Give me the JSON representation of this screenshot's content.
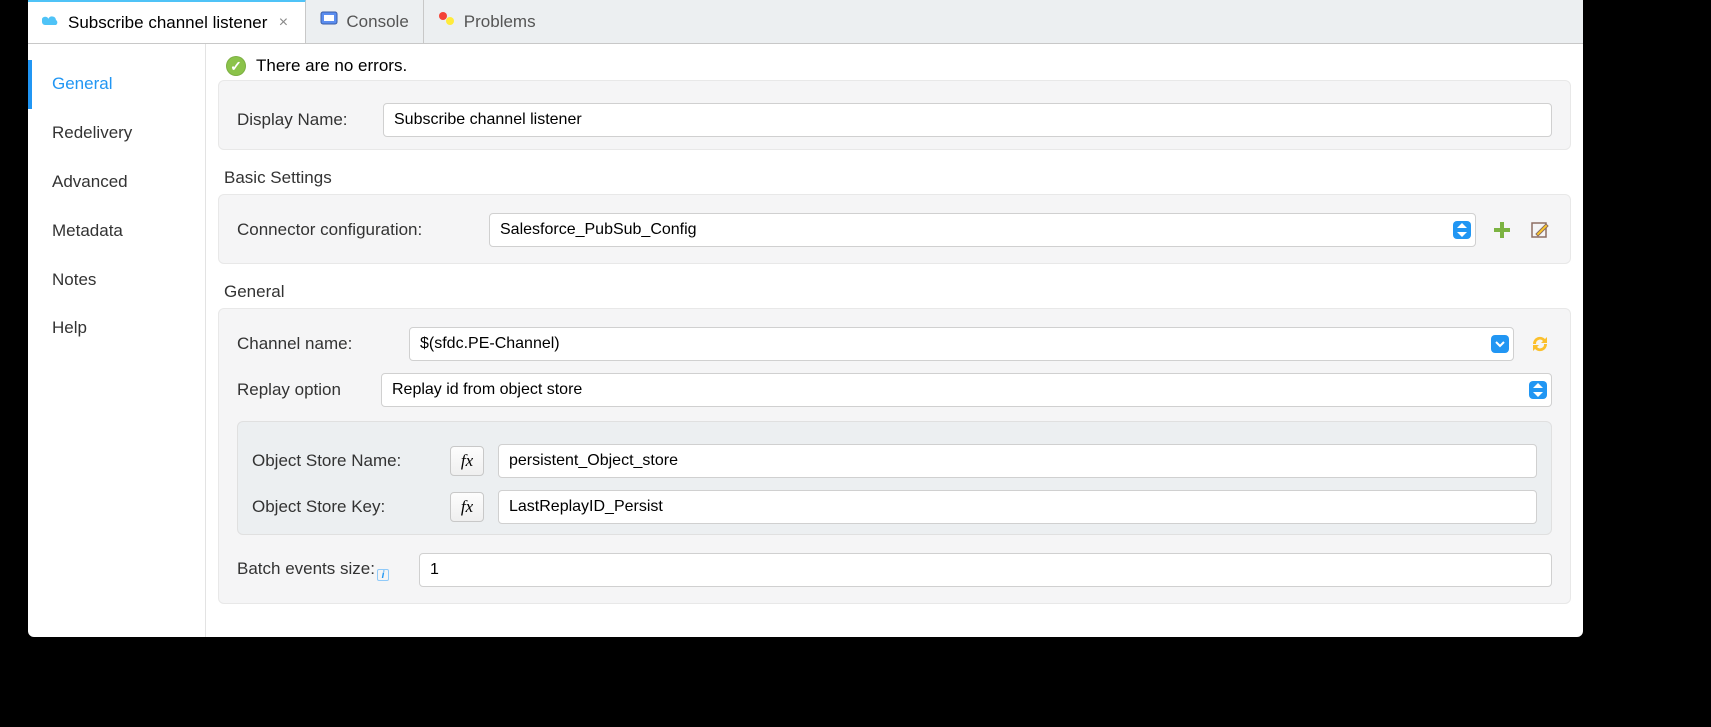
{
  "tabs": {
    "active": {
      "label": "Subscribe channel listener"
    },
    "console": {
      "label": "Console"
    },
    "problems": {
      "label": "Problems"
    }
  },
  "sidebar": {
    "items": [
      {
        "label": "General",
        "active": true
      },
      {
        "label": "Redelivery",
        "active": false
      },
      {
        "label": "Advanced",
        "active": false
      },
      {
        "label": "Metadata",
        "active": false
      },
      {
        "label": "Notes",
        "active": false
      },
      {
        "label": "Help",
        "active": false
      }
    ]
  },
  "status": {
    "text": "There are no errors."
  },
  "fields": {
    "display_name": {
      "label": "Display Name:",
      "value": "Subscribe channel listener"
    },
    "basic_heading": "Basic Settings",
    "connector": {
      "label": "Connector configuration:",
      "value": "Salesforce_PubSub_Config"
    },
    "general_heading": "General",
    "channel_name": {
      "label": "Channel name:",
      "value": "$(sfdc.PE-Channel)"
    },
    "replay_option": {
      "label": "Replay option",
      "value": "Replay id from object store"
    },
    "obj_store_name": {
      "label": "Object Store Name:",
      "value": "persistent_Object_store"
    },
    "obj_store_key": {
      "label": "Object Store Key:",
      "value": "LastReplayID_Persist"
    },
    "batch_size": {
      "label": "Batch events size:",
      "value": "1"
    }
  },
  "icons": {
    "add": "plus-icon",
    "edit": "edit-icon",
    "refresh": "refresh-icon"
  },
  "colors": {
    "accent": "#2196f3",
    "ok": "#8bc34a"
  }
}
